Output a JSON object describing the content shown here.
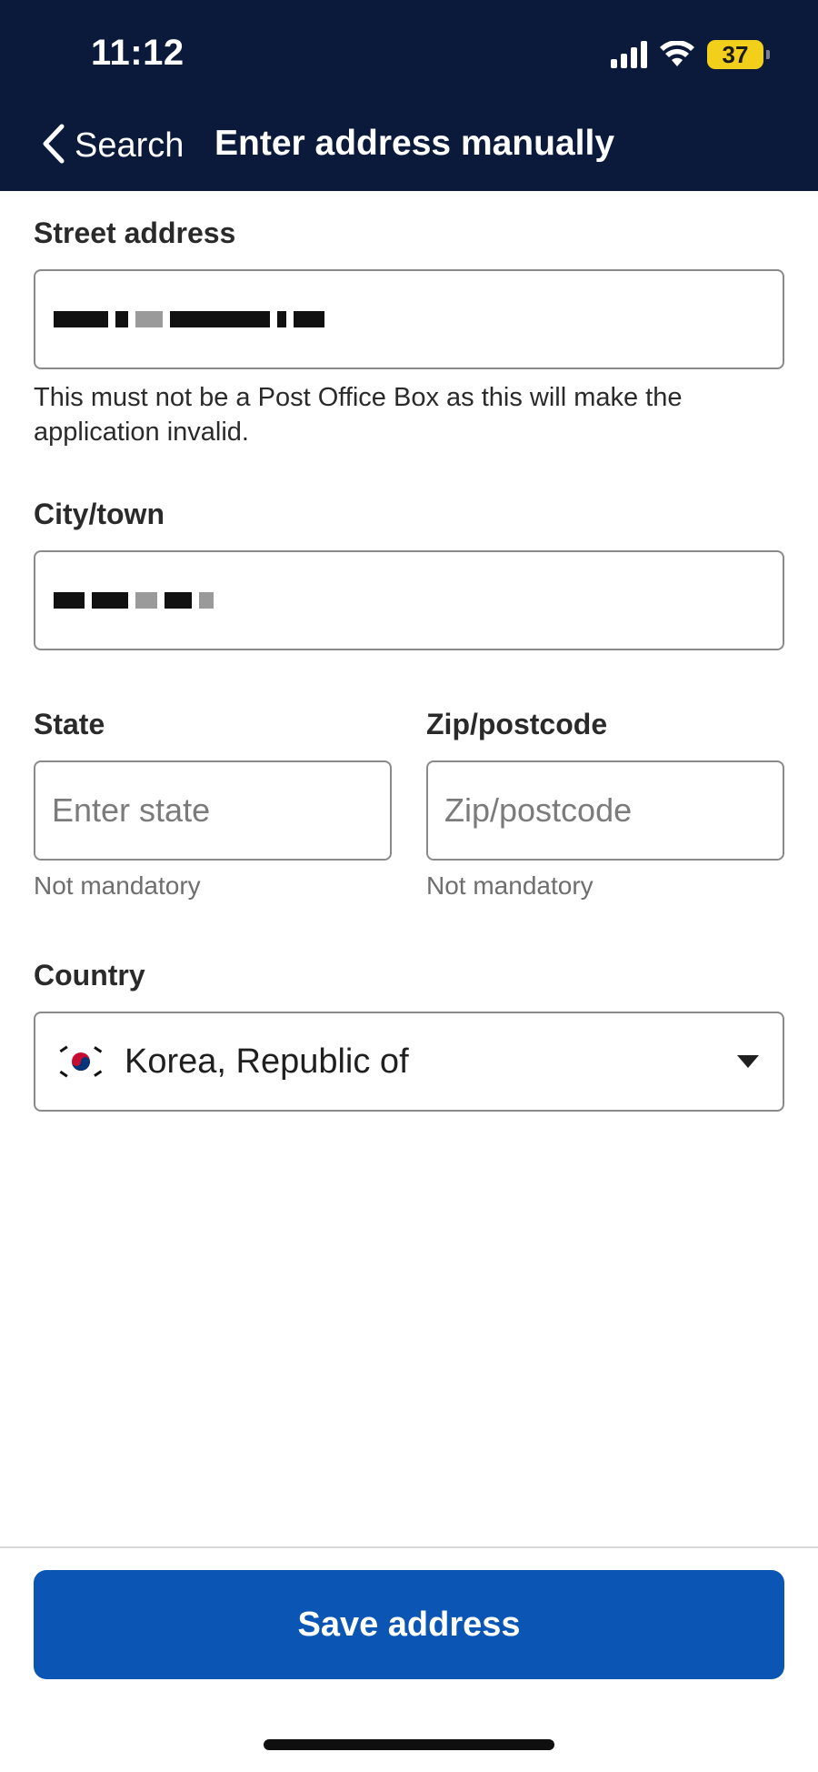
{
  "status_bar": {
    "time": "11:12",
    "battery": "37",
    "icons": [
      "signal-icon",
      "wifi-icon",
      "battery-icon"
    ]
  },
  "nav": {
    "back_label": "Search",
    "back_icon": "chevron-left-icon",
    "title": "Enter address manually"
  },
  "form": {
    "street": {
      "label": "Street address",
      "value": "",
      "helper": "This must not be a Post Office Box as this will make the application invalid."
    },
    "city": {
      "label": "City/town",
      "value": ""
    },
    "state": {
      "label": "State",
      "placeholder": "Enter state",
      "hint": "Not mandatory"
    },
    "zip": {
      "label": "Zip/postcode",
      "placeholder": "Zip/postcode",
      "hint": "Not mandatory"
    },
    "country": {
      "label": "Country",
      "value": "Korea, Republic of",
      "flag_icon": "korea-flag-icon",
      "caret_icon": "caret-down-icon"
    }
  },
  "actions": {
    "save_label": "Save address"
  },
  "colors": {
    "header_bg": "#0b1a3a",
    "primary": "#0b55b5",
    "battery": "#f2cf1a"
  }
}
